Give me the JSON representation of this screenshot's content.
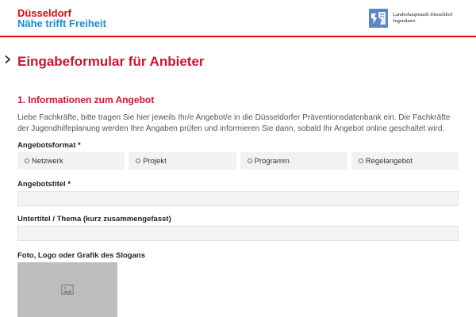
{
  "header": {
    "brand_line1": "Düsseldorf",
    "brand_line2": "Nähe trifft Freiheit",
    "logo_line1": "Landeshauptstadt Düsseldorf",
    "logo_line2": "Jugendamt",
    "colors": {
      "brand_red": "#e30613",
      "brand_blue": "#1a8fd0",
      "logo_blue": "#5d87c4"
    }
  },
  "page": {
    "title": "Eingabeformular für Anbieter",
    "chevron_icon": "chevron-right-icon"
  },
  "section": {
    "title": "1. Informationen zum Angebot",
    "intro": "Liebe Fachkräfte, bitte tragen Sie hier jeweils Ihr/e Angebot/e in die Düsseldorfer Präventionsdatenbank ein. Die Fachkräfte der Jugendhilfeplanung werden Ihre Angaben prüfen und informieren Sie dann, sobald Ihr Angebot online geschaltet wird."
  },
  "form": {
    "format_label": "Angebotsformat *",
    "format_options": [
      "Netzwerk",
      "Projekt",
      "Programm",
      "Regelangebot"
    ],
    "title_label": "Angebotstitel *",
    "title_value": "",
    "subtitle_label": "Untertitel / Thema (kurz zusammengefasst)",
    "subtitle_value": "",
    "image_label": "Foto, Logo oder Grafik des Slogans",
    "image_icon": "image-placeholder-icon"
  }
}
